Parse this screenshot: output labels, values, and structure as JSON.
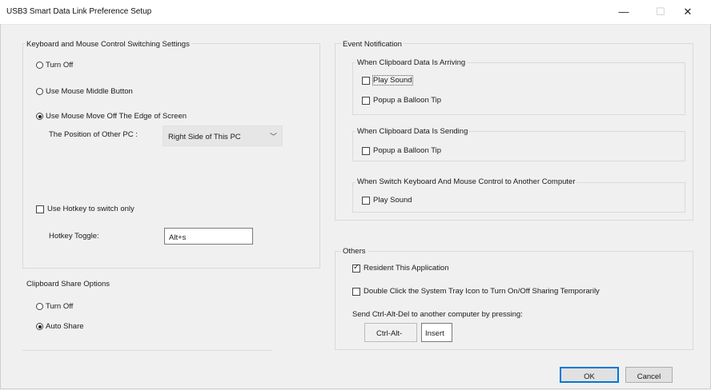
{
  "window": {
    "title": "USB3 Smart Data Link Preference Setup",
    "minimize_glyph": "—",
    "maximize_glyph": "☐",
    "close_glyph": "✕"
  },
  "kbm": {
    "title": "Keyboard and Mouse Control Switching Settings",
    "options": [
      "Turn Off",
      "Use Mouse Middle Button",
      "Use Mouse Move Off The Edge of Screen"
    ],
    "selected_option": "Use Mouse Move Off The Edge of Screen",
    "position_label": "The Position of Other PC :",
    "position_value": "Right Side of This PC",
    "hotkey_checkbox_label": "Use Hotkey to switch only",
    "hotkey_checked": false,
    "hotkey_toggle_label": "Hotkey Toggle:",
    "hotkey_toggle_value": "Alt+s"
  },
  "clipboard": {
    "title": "Clipboard Share Options",
    "options": [
      "Turn Off",
      "Auto Share"
    ],
    "selected_option": "Auto Share"
  },
  "event": {
    "title": "Event Notification",
    "arriving": {
      "title": "When Clipboard Data Is Arriving",
      "play_sound": "Play Sound",
      "popup": "Popup a Balloon Tip"
    },
    "sending": {
      "title": "When Clipboard Data Is Sending",
      "popup": "Popup a Balloon Tip"
    },
    "switch": {
      "title": "When Switch Keyboard And Mouse Control to Another Computer",
      "play_sound": "Play Sound"
    }
  },
  "others": {
    "title": "Others",
    "resident_label": "Resident This Application",
    "resident_checked": true,
    "doubleclick_label": "Double Click the System Tray Icon to Turn On/Off Sharing Temporarily",
    "doubleclick_checked": false,
    "cad_label": "Send Ctrl-Alt-Del to another computer by pressing:",
    "cad_prefix": "Ctrl-Alt-",
    "cad_key": "Insert"
  },
  "buttons": {
    "ok": "OK",
    "cancel": "Cancel"
  }
}
